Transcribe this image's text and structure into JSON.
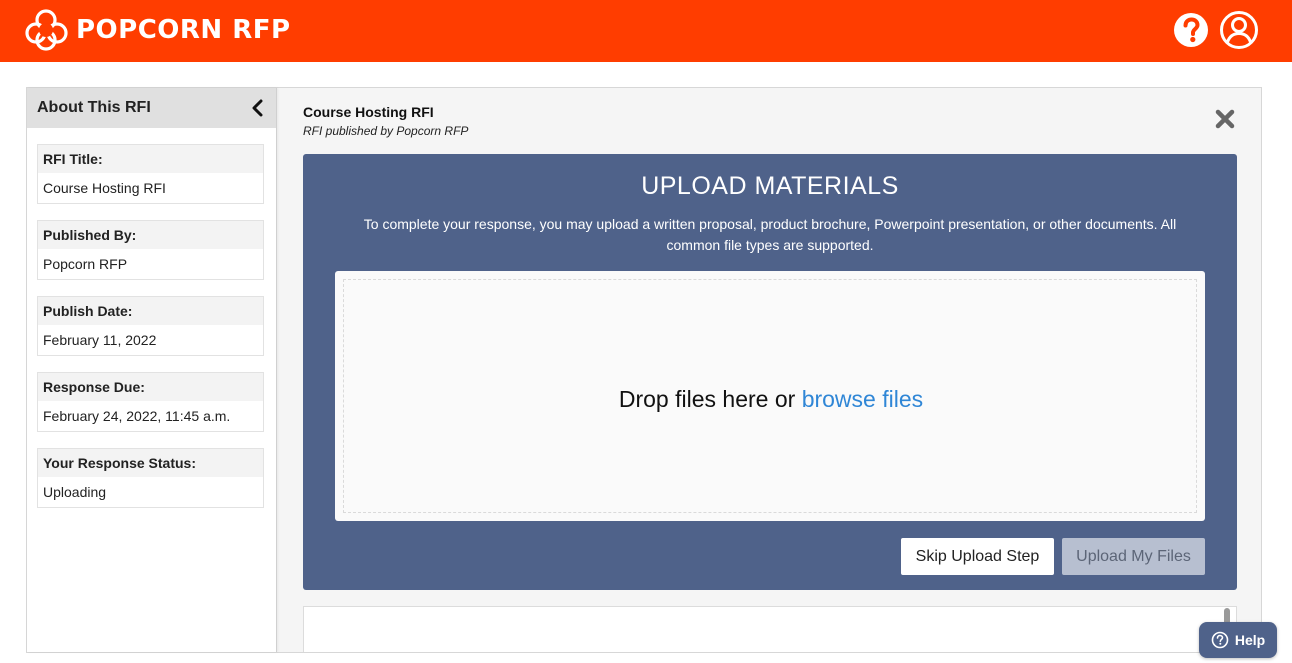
{
  "header": {
    "brand": "POPCORN RFP",
    "icons": {
      "logo": "popcorn-cloud-icon",
      "help": "question-circle-icon",
      "account": "user-circle-icon"
    },
    "color": "#ff3d00"
  },
  "sidebar": {
    "title": "About This RFI",
    "collapse_icon": "chevron-left-icon",
    "fields": [
      {
        "label": "RFI Title:",
        "value": "Course Hosting RFI"
      },
      {
        "label": "Published By:",
        "value": "Popcorn RFP"
      },
      {
        "label": "Publish Date:",
        "value": "February 11, 2022"
      },
      {
        "label": "Response Due:",
        "value": "February 24, 2022, 11:45 a.m."
      },
      {
        "label": "Your Response Status:",
        "value": "Uploading"
      }
    ]
  },
  "main": {
    "title": "Course Hosting RFI",
    "subtitle": "RFI published by Popcorn RFP",
    "close_icon": "close-x-icon"
  },
  "upload": {
    "heading": "UPLOAD MATERIALS",
    "description": "To complete your response, you may upload a written proposal, product brochure, Powerpoint presentation, or other documents. All common file types are supported.",
    "drop_text": "Drop files here or ",
    "browse_text": "browse files",
    "skip_label": "Skip Upload Step",
    "upload_label": "Upload My Files",
    "panel_color": "#4f628a",
    "link_color": "#2f86d6"
  },
  "help_widget": {
    "label": "Help",
    "icon": "question-circle-icon"
  }
}
